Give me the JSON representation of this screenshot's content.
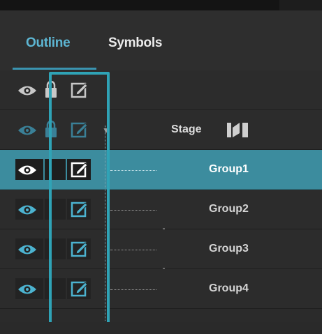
{
  "tabs": [
    {
      "label": "Outline",
      "active": true
    },
    {
      "label": "Symbols",
      "active": false
    }
  ],
  "rows": [
    {
      "kind": "header",
      "label": ""
    },
    {
      "kind": "stage",
      "label": "Stage",
      "icon": "stage-icon"
    },
    {
      "kind": "group",
      "label": "Group1",
      "selected": true
    },
    {
      "kind": "group",
      "label": "Group2",
      "selected": false
    },
    {
      "kind": "group",
      "label": "Group3",
      "selected": false
    },
    {
      "kind": "group",
      "label": "Group4",
      "selected": false
    }
  ],
  "colors": {
    "accent": "#5db6d3",
    "selected_row": "#3c8c9e",
    "highlight_box": "#2fa3b6"
  }
}
